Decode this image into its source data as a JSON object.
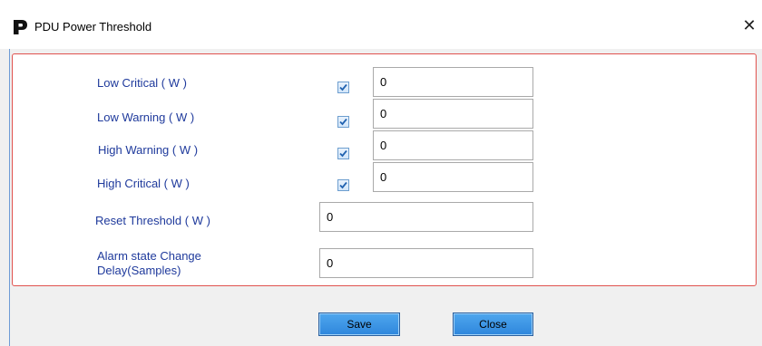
{
  "window": {
    "title": "PDU Power Threshold",
    "close_glyph": "✕"
  },
  "fields": [
    {
      "label": "Low Critical ( W )",
      "checked": true,
      "value": "0"
    },
    {
      "label": "Low Warning ( W )",
      "checked": true,
      "value": "0"
    },
    {
      "label": "High Warning ( W )",
      "checked": true,
      "value": "0"
    },
    {
      "label": "High Critical ( W )",
      "checked": true,
      "value": "0"
    },
    {
      "label": "Reset Threshold ( W )",
      "value": "0"
    },
    {
      "label": "Alarm state Change Delay(Samples)",
      "value": "0"
    }
  ],
  "buttons": {
    "save_label": "Save",
    "close_label": "Close"
  },
  "colors": {
    "label": "#1f3a9c",
    "panel_border": "#e0524e",
    "button": "#3a93e4"
  },
  "icons": {
    "app": "pdu-logo-icon",
    "check": "checkmark-icon",
    "close": "close-icon"
  }
}
